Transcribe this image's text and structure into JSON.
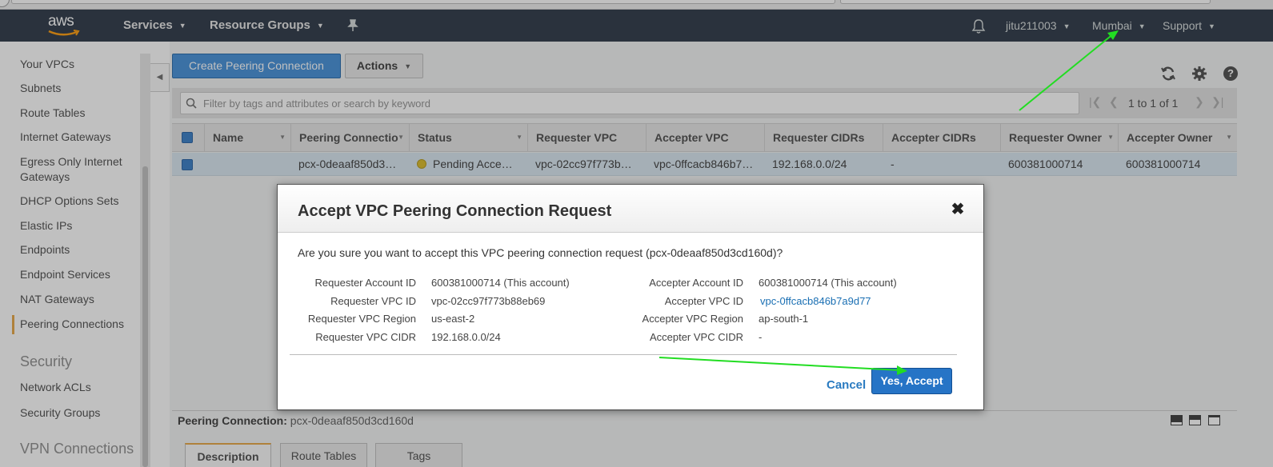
{
  "topnav": {
    "logo": "aws",
    "services": "Services",
    "resource_groups": "Resource Groups",
    "account": "jitu211003",
    "region": "Mumbai",
    "support": "Support"
  },
  "sidebar": {
    "items": [
      {
        "label": "Your VPCs"
      },
      {
        "label": "Subnets"
      },
      {
        "label": "Route Tables"
      },
      {
        "label": "Internet Gateways"
      },
      {
        "label": "Egress Only Internet Gateways"
      },
      {
        "label": "DHCP Options Sets"
      },
      {
        "label": "Elastic IPs"
      },
      {
        "label": "Endpoints"
      },
      {
        "label": "Endpoint Services"
      },
      {
        "label": "NAT Gateways"
      },
      {
        "label": "Peering Connections"
      }
    ],
    "security_header": "Security",
    "security_items": [
      {
        "label": "Network ACLs"
      },
      {
        "label": "Security Groups"
      }
    ],
    "vpn_header": "VPN Connections"
  },
  "toolbar": {
    "create_label": "Create Peering Connection",
    "actions_label": "Actions"
  },
  "search": {
    "placeholder": "Filter by tags and attributes or search by keyword"
  },
  "pager": {
    "text": "1 to 1 of 1"
  },
  "table": {
    "columns": [
      "Name",
      "Peering Connectio",
      "Status",
      "Requester VPC",
      "Accepter VPC",
      "Requester CIDRs",
      "Accepter CIDRs",
      "Requester Owner",
      "Accepter Owner"
    ],
    "row": {
      "name": "",
      "peering_id": "pcx-0deaaf850d3…",
      "status": "Pending Acce…",
      "requester_vpc": "vpc-02cc97f773b…",
      "accepter_vpc": "vpc-0ffcacb846b7…",
      "requester_cidrs": "192.168.0.0/24",
      "accepter_cidrs": "-",
      "requester_owner": "600381000714",
      "accepter_owner": "600381000714"
    }
  },
  "modal": {
    "title": "Accept VPC Peering Connection Request",
    "question": "Are you sure you want to accept this VPC peering connection request (pcx-0deaaf850d3cd160d)?",
    "left": [
      {
        "label": "Requester Account ID",
        "value": "600381000714 (This account)"
      },
      {
        "label": "Requester VPC ID",
        "value": "vpc-02cc97f773b88eb69"
      },
      {
        "label": "Requester VPC Region",
        "value": "us-east-2"
      },
      {
        "label": "Requester VPC CIDR",
        "value": "192.168.0.0/24"
      }
    ],
    "right": [
      {
        "label": "Accepter Account ID",
        "value": "600381000714 (This account)"
      },
      {
        "label": "Accepter VPC ID",
        "value": "vpc-0ffcacb846b7a9d77"
      },
      {
        "label": "Accepter VPC Region",
        "value": "ap-south-1"
      },
      {
        "label": "Accepter VPC CIDR",
        "value": "-"
      }
    ],
    "cancel_label": "Cancel",
    "accept_label": "Yes, Accept"
  },
  "bottom": {
    "title_label": "Peering Connection:",
    "title_id": "pcx-0deaaf850d3cd160d",
    "tabs": [
      "Description",
      "Route Tables",
      "Tags"
    ]
  },
  "colors": {
    "nav_bg": "#232f3e",
    "primary": "#2674c6",
    "annotation_arrow": "#22dd22",
    "status_pending": "#d9b81e"
  }
}
